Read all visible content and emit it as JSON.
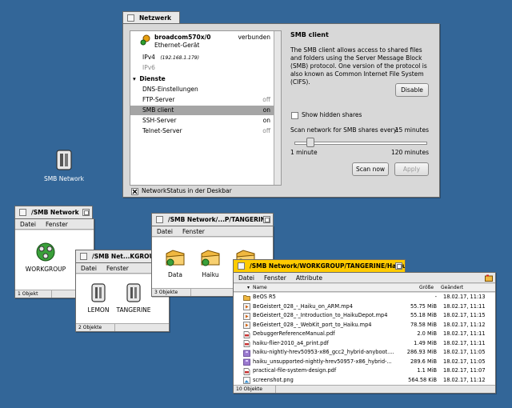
{
  "desktop_icon": {
    "label": "SMB Network"
  },
  "network": {
    "title": "Netzwerk",
    "device": {
      "name": "broadcom570x/0",
      "status": "verbunden",
      "type": "Ethernet-Gerät"
    },
    "ipv4_label": "IPv4",
    "ipv4_value": "(192.168.1.179)",
    "ipv6_label": "IPv6",
    "services_header": "Dienste",
    "services": [
      {
        "name": "DNS-Einstellungen",
        "value": ""
      },
      {
        "name": "FTP-Server",
        "value": "off"
      },
      {
        "name": "SMB client",
        "value": "on"
      },
      {
        "name": "SSH-Server",
        "value": "on"
      },
      {
        "name": "Telnet-Server",
        "value": "off"
      }
    ],
    "deskbar_checkbox": "NetworkStatus in der Deskbar",
    "smb_title": "SMB client",
    "smb_description": "The SMB client allows access to shared files and folders using the Server Message Block (SMB) protocol. One version of the protocol is also known as Common Internet File System (CIFS).",
    "disable_button": "Disable",
    "show_hidden": "Show hidden shares",
    "scan_label": "Scan network for SMB shares every:",
    "scan_value": "15 minutes",
    "slider_min": "1 minute",
    "slider_max": "120 minutes",
    "slider_level": 0.12,
    "scan_now_button": "Scan now",
    "apply_button": "Apply"
  },
  "win_smb": {
    "title": "/SMB Network",
    "menu": [
      "Datei",
      "Fenster"
    ],
    "items": [
      "WORKGROUP"
    ],
    "status": "1 Objekt"
  },
  "win_workgroup": {
    "title": "/SMB Net...KGROUP",
    "menu": [
      "Datei",
      "Fenster"
    ],
    "items": [
      "LEMON",
      "TANGERINE"
    ],
    "status": "2 Objekte"
  },
  "win_tangerine": {
    "title": "/SMB Network/...P/TANGERINE",
    "menu": [
      "Datei",
      "Fenster"
    ],
    "items": [
      "Data",
      "Haiku",
      ""
    ],
    "status": "3 Objekte"
  },
  "win_haiku": {
    "title": "/SMB Network/WORKGROUP/TANGERINE/Haiku",
    "menu": [
      "Datei",
      "Fenster",
      "Attribute"
    ],
    "columns": [
      "Name",
      "Größe",
      "Geändert"
    ],
    "status": "10 Objekte",
    "rows": [
      {
        "name": "BeOS R5",
        "size": "-",
        "date": "18.02.17, 11:13",
        "icon": "folder"
      },
      {
        "name": "BeGeistert_028_-_Haiku_on_ARM.mp4",
        "size": "55.75 MiB",
        "date": "18.02.17, 11:11",
        "icon": "video"
      },
      {
        "name": "BeGeistert_028_-_Introduction_to_HaikuDepot.mp4",
        "size": "55.18 MiB",
        "date": "18.02.17, 11:15",
        "icon": "video"
      },
      {
        "name": "BeGeistert_028_-_WebKit_port_to_Haiku.mp4",
        "size": "78.58 MiB",
        "date": "18.02.17, 11:12",
        "icon": "video"
      },
      {
        "name": "DebuggerReferenceManual.pdf",
        "size": "2.0 MiB",
        "date": "18.02.17, 11:11",
        "icon": "pdf"
      },
      {
        "name": "haiku-flier-2010_a4_print.pdf",
        "size": "1.49 MiB",
        "date": "18.02.17, 11:11",
        "icon": "pdf"
      },
      {
        "name": "haiku-nightly-hrev50953-x86_gcc2_hybrid-anyboot....",
        "size": "286.93 MiB",
        "date": "18.02.17, 11:05",
        "icon": "archive"
      },
      {
        "name": "haiku_unsupported-nightly-hrev50957-x86_hybrid-...",
        "size": "289.6 MiB",
        "date": "18.02.17, 11:05",
        "icon": "archive"
      },
      {
        "name": "practical-file-system-design.pdf",
        "size": "1.1 MiB",
        "date": "18.02.17, 11:07",
        "icon": "pdf"
      },
      {
        "name": "screenshot.png",
        "size": "564.58 KiB",
        "date": "18.02.17, 11:12",
        "icon": "image"
      }
    ]
  }
}
